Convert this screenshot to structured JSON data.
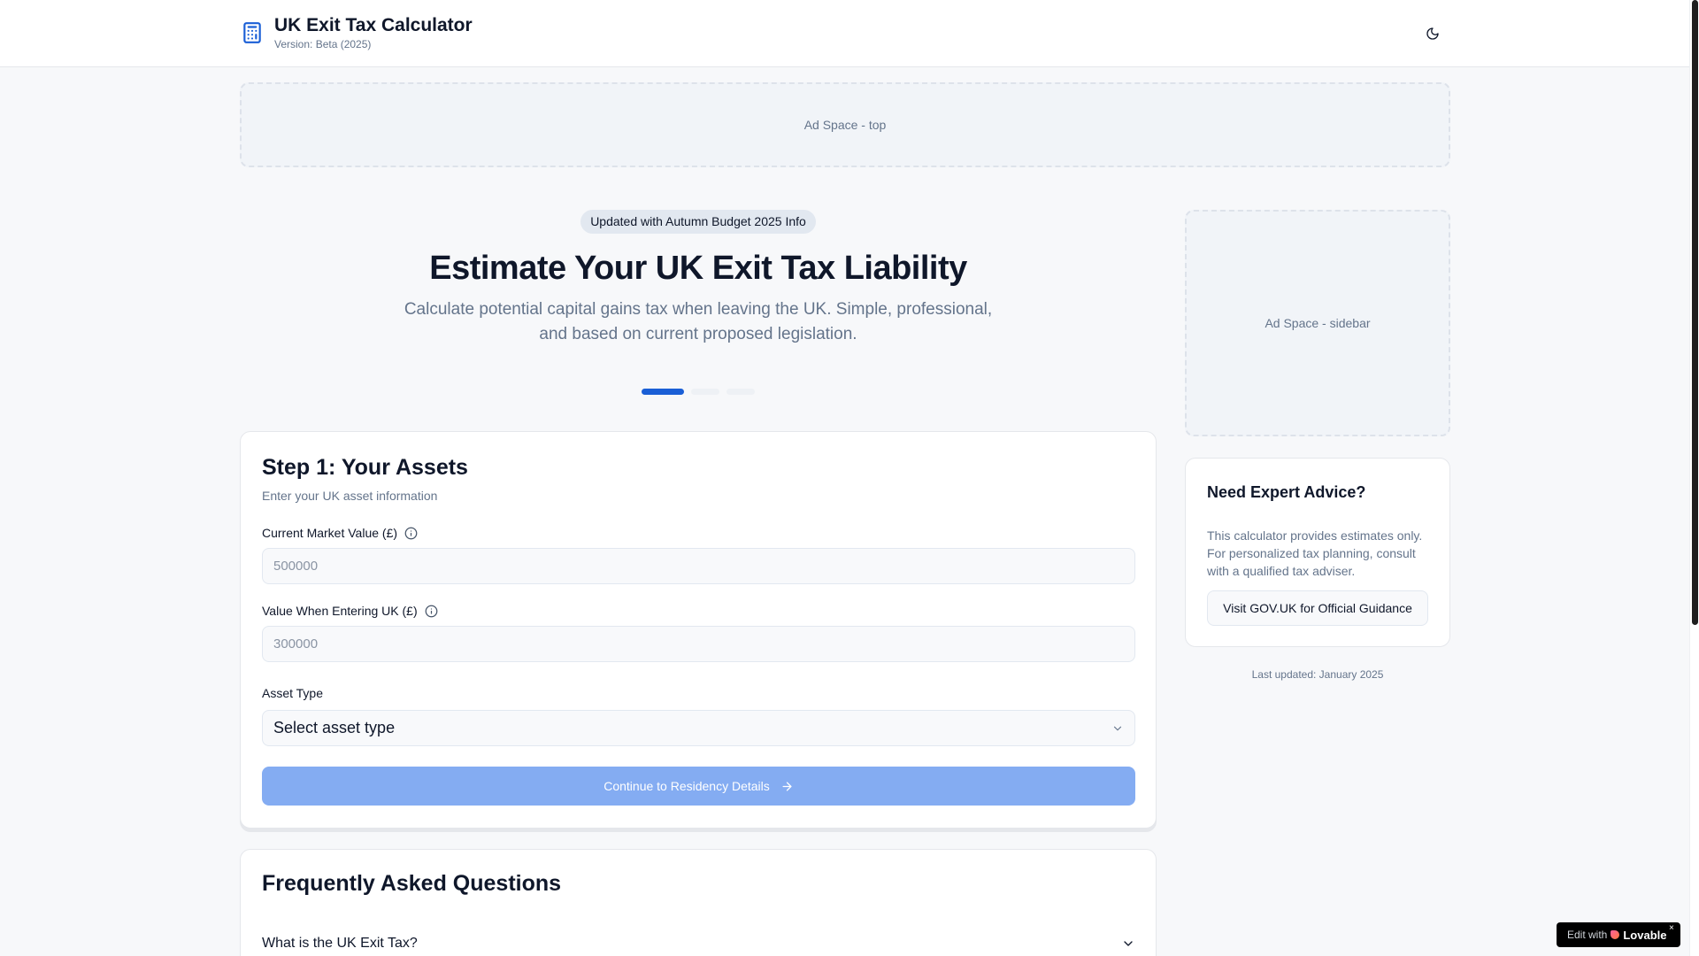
{
  "header": {
    "title": "UK Exit Tax Calculator",
    "version": "Version: Beta (2025)",
    "theme_toggle_icon": "moon-icon"
  },
  "ads": {
    "top": "Ad Space - top",
    "sidebar": "Ad Space - sidebar"
  },
  "hero": {
    "badge": "Updated with Autumn Budget 2025 Info",
    "title": "Estimate Your UK Exit Tax Liability",
    "subtitle": "Calculate potential capital gains tax when leaving the UK. Simple, professional, and based on current proposed legislation."
  },
  "progress": {
    "current_step": 1,
    "total_steps": 3
  },
  "step1": {
    "title": "Step 1: Your Assets",
    "description": "Enter your UK asset information",
    "market_value_label": "Current Market Value (£)",
    "market_value_placeholder": "500000",
    "entry_value_label": "Value When Entering UK (£)",
    "entry_value_placeholder": "300000",
    "asset_type_label": "Asset Type",
    "asset_type_value": "Select asset type",
    "continue_label": "Continue to Residency Details"
  },
  "faq": {
    "title": "Frequently Asked Questions",
    "items": [
      {
        "question": "What is the UK Exit Tax?"
      }
    ]
  },
  "advice": {
    "title": "Need Expert Advice?",
    "text": "This calculator provides estimates only. For personalized tax planning, consult with a qualified tax adviser.",
    "button": "Visit GOV.UK for Official Guidance"
  },
  "last_updated": "Last updated: January 2025",
  "lovable_badge": {
    "edit_text": "Edit with",
    "brand": "Lovable",
    "close": "×"
  },
  "colors": {
    "accent": "#1a5fd6",
    "button_disabled": "#84acf2",
    "background": "#f7f8fa"
  }
}
